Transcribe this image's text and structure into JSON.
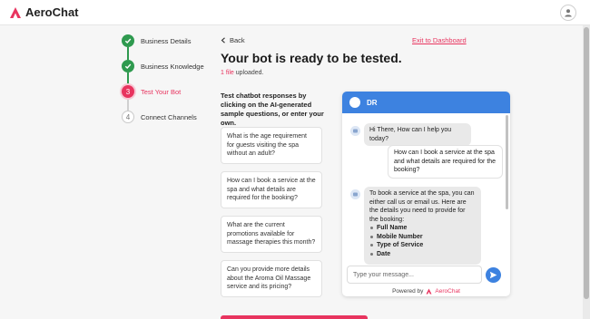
{
  "app": {
    "name": "AeroChat"
  },
  "steps": [
    {
      "number": "1",
      "label": "Business Details",
      "state": "done"
    },
    {
      "number": "2",
      "label": "Business Knowledge",
      "state": "done"
    },
    {
      "number": "3",
      "label": "Test Your Bot",
      "state": "active"
    },
    {
      "number": "4",
      "label": "Connect Channels",
      "state": "todo"
    }
  ],
  "nav": {
    "back_label": "Back",
    "exit_label": "Exit to Dashboard"
  },
  "page": {
    "title": "Your bot is ready to be tested.",
    "file_count": "1 file",
    "uploaded_suffix": " uploaded.",
    "instructions": "Test chatbot responses by clicking on the AI-generated sample questions, or enter your own."
  },
  "sample_questions": [
    "What is the age requirement for guests visiting the spa without an adult?",
    "How can I book a service at the spa and what details are required for the booking?",
    "What are the current promotions available for massage therapies this month?",
    "Can you provide more details about the Aroma Oil Massage service and its pricing?"
  ],
  "chat": {
    "bot_name": "DR",
    "greeting": "Hi There, How can I help you today?",
    "user_message": "How can I book a service at the spa and what details are required for the booking?",
    "bot_reply": "To book a service at the spa, you can either call us or email us. Here are the details you need to provide for the booking:",
    "bot_reply_items": [
      "Full Name",
      "Mobile Number",
      "Type of Service",
      "Date"
    ],
    "input_placeholder": "Type your message...",
    "powered_by": "Powered by",
    "powered_brand": "AeroChat"
  },
  "colors": {
    "brand": "#e8345f",
    "success": "#2f9a4f",
    "chat_header": "#3d82e0"
  },
  "icons": [
    "aerochat-logo-icon",
    "user-icon",
    "check-icon",
    "chevron-left-icon",
    "bot-icon",
    "send-icon"
  ]
}
